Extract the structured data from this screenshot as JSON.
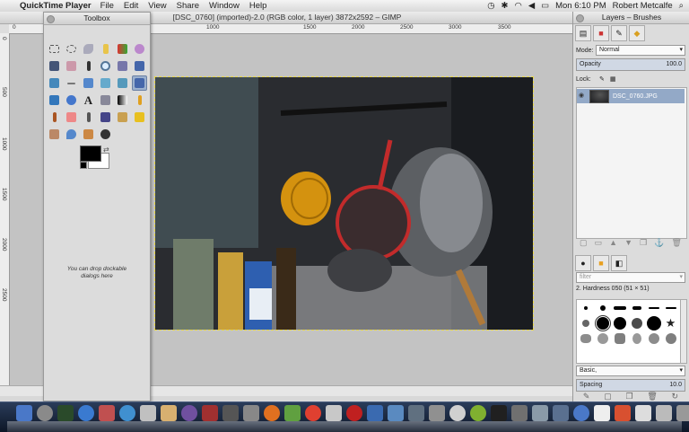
{
  "menubar": {
    "app_name": "QuickTime Player",
    "items": [
      "File",
      "Edit",
      "View",
      "Share",
      "Window",
      "Help"
    ],
    "clock": "Mon 6:10 PM",
    "user": "Robert Metcalfe"
  },
  "image_window": {
    "title": "[DSC_0760] (imported)-2.0 (RGB color, 1 layer) 3872x2592 – GIMP",
    "ruler_labels": [
      "0",
      "500",
      "1000",
      "1500",
      "2000",
      "2500",
      "3000",
      "3500"
    ],
    "vruler_labels": [
      "0",
      "500",
      "1000",
      "1500",
      "2000",
      "2500"
    ]
  },
  "toolbox": {
    "title": "Toolbox",
    "drop_note": "You can drop dockable dialogs here"
  },
  "layers_dock": {
    "title": "Layers – Brushes",
    "mode_label": "Mode:",
    "mode_value": "Normal",
    "opacity_label": "Opacity",
    "opacity_value": "100.0",
    "lock_label": "Lock:",
    "layer_name": "DSC_0760.JPG",
    "filter_placeholder": "filter",
    "brush_name": "2. Hardness 050 (51 × 51)",
    "brush_set": "Basic,",
    "spacing_label": "Spacing",
    "spacing_value": "10.0"
  },
  "colors": {
    "selection_blue": "#93a9c7",
    "foreground": "#000000",
    "background": "#ffffff"
  }
}
